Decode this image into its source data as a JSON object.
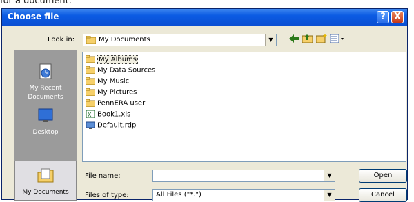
{
  "caption": "for a document.",
  "window": {
    "title": "Choose file"
  },
  "titlebar": {
    "help": "?",
    "close": "X"
  },
  "toolbar": {
    "lookin_label": "Look in:",
    "lookin_value": "My Documents",
    "back_icon": "back-arrow-icon",
    "up_icon": "up-folder-icon",
    "new_folder_icon": "new-folder-icon",
    "views_icon": "views-menu-icon"
  },
  "places": [
    {
      "label_line1": "My Recent",
      "label_line2": "Documents",
      "icon": "recent-documents-icon"
    },
    {
      "label_line1": "Desktop",
      "label_line2": "",
      "icon": "desktop-icon"
    },
    {
      "label_line1": "My Documents",
      "label_line2": "",
      "icon": "my-documents-icon",
      "selected": true
    }
  ],
  "files": [
    {
      "name": "My Albums",
      "icon": "folder-icon",
      "selected": true
    },
    {
      "name": "My Data Sources",
      "icon": "folder-icon"
    },
    {
      "name": "My Music",
      "icon": "folder-icon"
    },
    {
      "name": "My Pictures",
      "icon": "folder-icon"
    },
    {
      "name": "PennERA user",
      "icon": "folder-icon"
    },
    {
      "name": "Book1.xls",
      "icon": "excel-file-icon"
    },
    {
      "name": "Default.rdp",
      "icon": "rdp-file-icon"
    }
  ],
  "form": {
    "file_name_label": "File name:",
    "file_name_value": "",
    "file_type_label": "Files of type:",
    "file_type_value": "All Files (\"*.\")"
  },
  "buttons": {
    "open": "Open",
    "cancel": "Cancel"
  },
  "colors": {
    "title_bar": "#0b5be3",
    "places_bg": "#9b9b9b",
    "dialog_bg": "#ece9d8"
  }
}
